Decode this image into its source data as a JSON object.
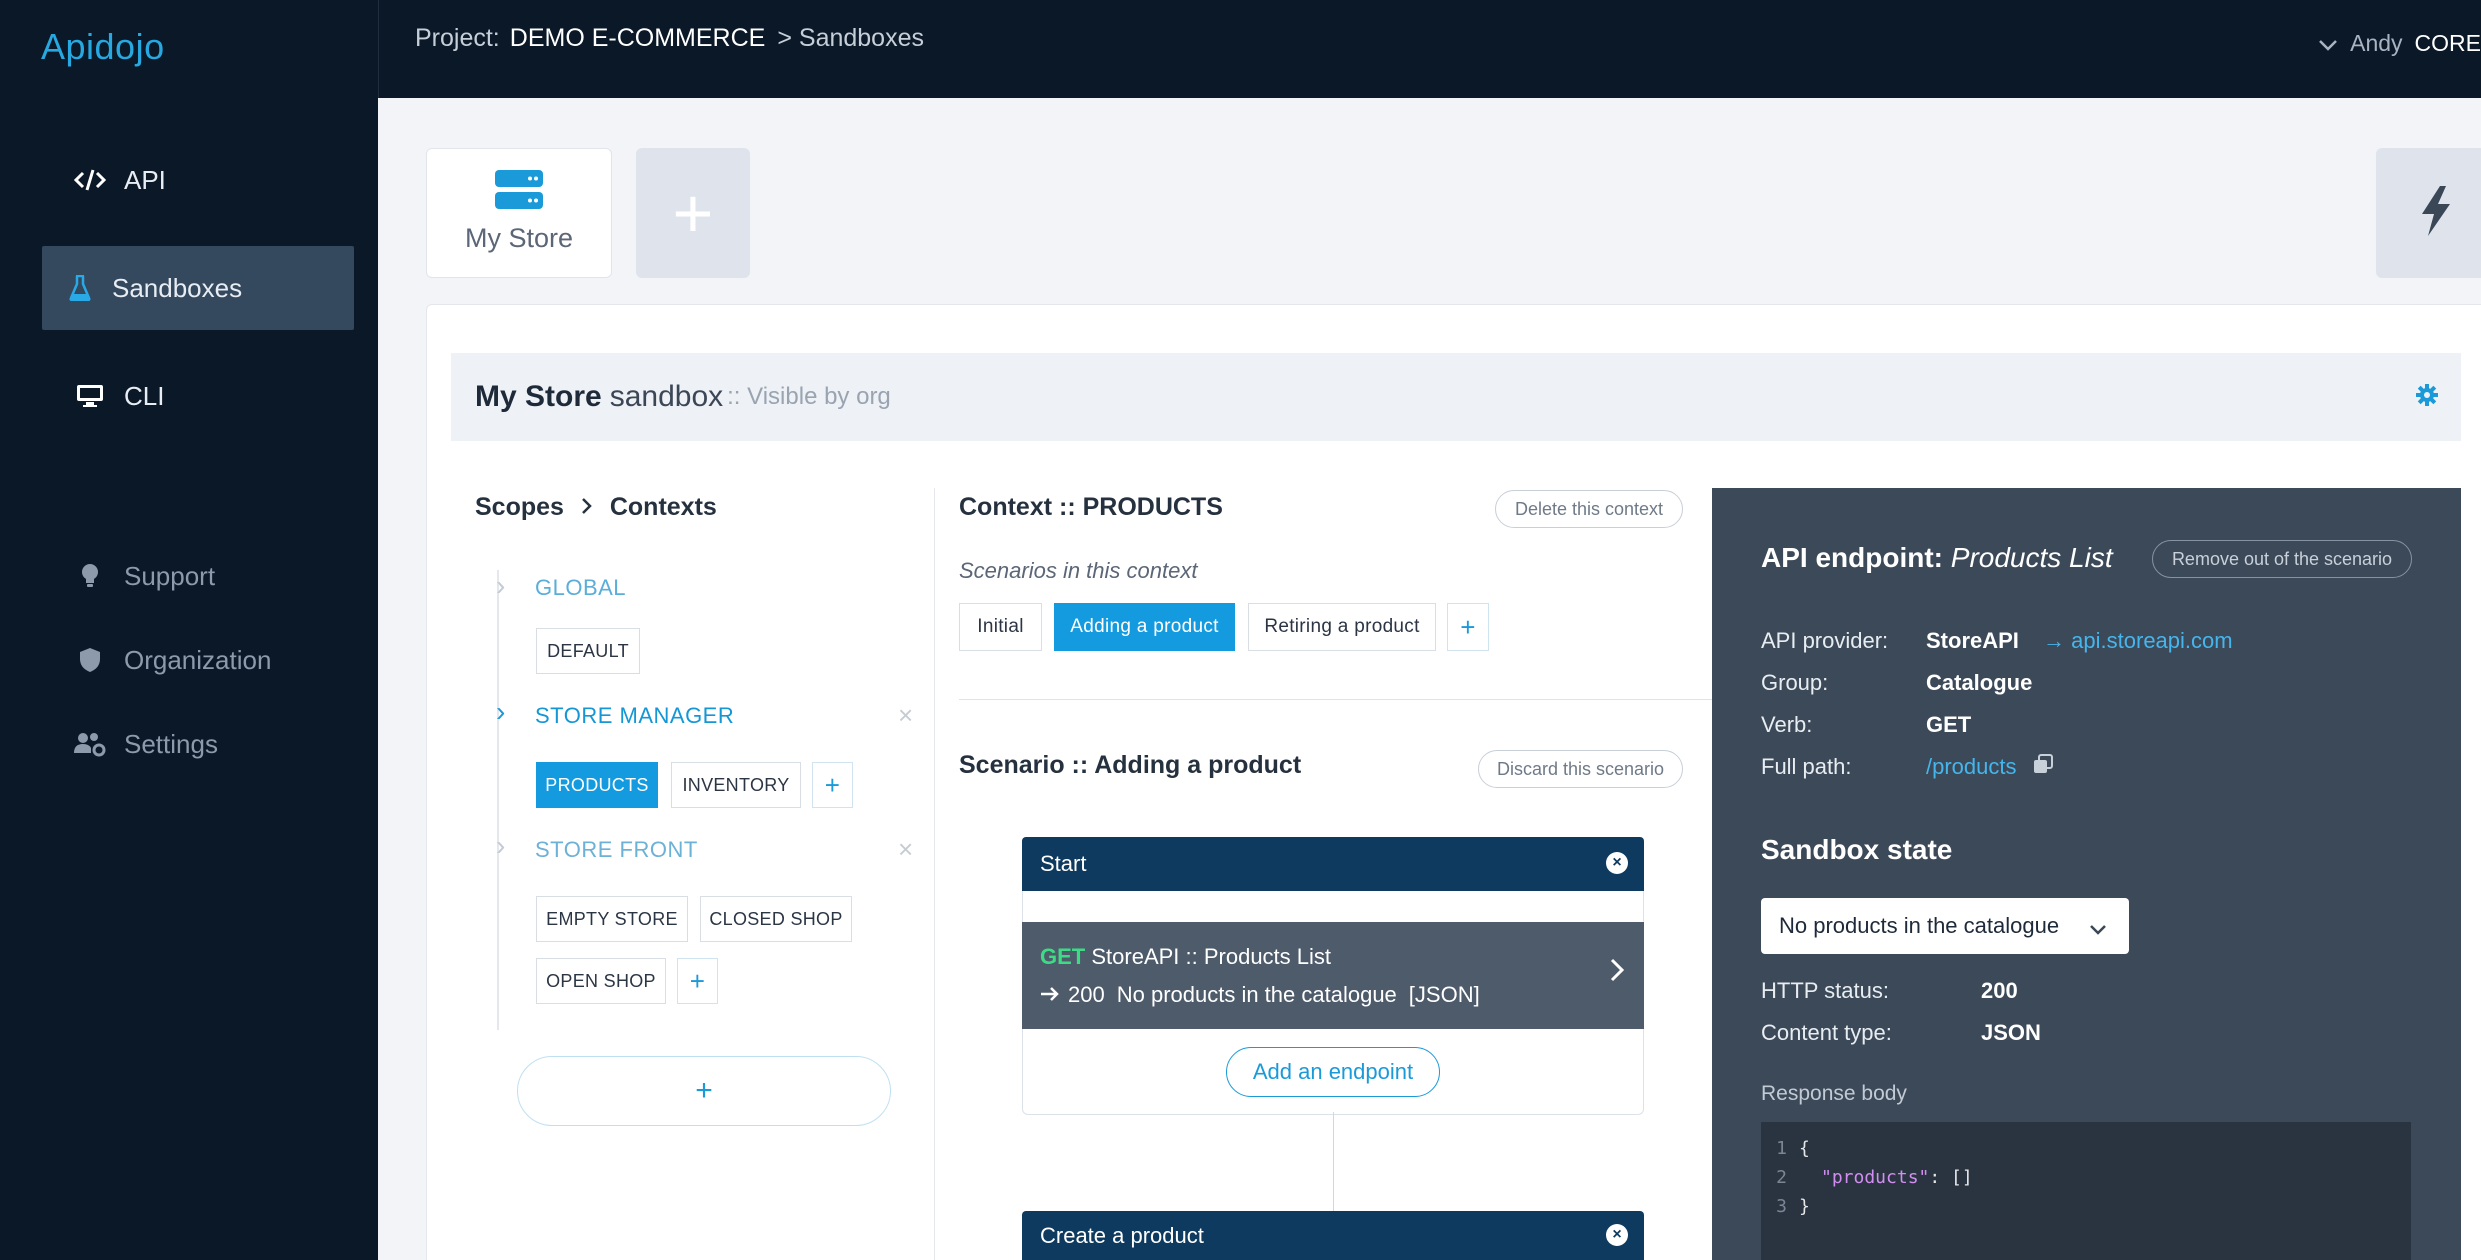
{
  "app": {
    "brand": "Apidojo"
  },
  "sidebar": {
    "items": [
      {
        "label": "API",
        "icon": "code-icon"
      },
      {
        "label": "Sandboxes",
        "icon": "flask-icon"
      },
      {
        "label": "CLI",
        "icon": "monitor-icon"
      }
    ],
    "secondary": [
      {
        "label": "Support",
        "icon": "lightbulb-icon"
      },
      {
        "label": "Organization",
        "icon": "shield-icon"
      },
      {
        "label": "Settings",
        "icon": "users-gear-icon"
      }
    ]
  },
  "topbar": {
    "project_prefix": "Project:",
    "project_name": "DEMO E-COMMERCE",
    "separator": ">",
    "current": "Sandboxes",
    "user": "Andy",
    "org": "CORE"
  },
  "tiles": {
    "store_label": "My Store",
    "add_symbol": "+"
  },
  "sandbox": {
    "name": "My Store",
    "kind": "sandbox",
    "visibility": ":: Visible by org"
  },
  "scopes": {
    "title_scopes": "Scopes",
    "title_contexts": "Contexts",
    "global": {
      "label": "GLOBAL",
      "chips": [
        "DEFAULT"
      ]
    },
    "manager": {
      "label": "STORE MANAGER",
      "chips": [
        "PRODUCTS",
        "INVENTORY"
      ]
    },
    "front": {
      "label": "STORE FRONT",
      "chips": [
        "EMPTY STORE",
        "CLOSED SHOP",
        "OPEN SHOP"
      ]
    },
    "add": "+"
  },
  "context": {
    "title": "Context :: PRODUCTS",
    "delete_label": "Delete this context",
    "scenarios_label": "Scenarios in this context",
    "scenarios": [
      "Initial",
      "Adding a product",
      "Retiring a product"
    ],
    "active_scenario": "Adding a product"
  },
  "scenario": {
    "title": "Scenario :: Adding a product",
    "discard_label": "Discard this scenario",
    "start_label": "Start",
    "endpoint_verb": "GET",
    "endpoint_name": "StoreAPI :: Products List",
    "endpoint_status": "200",
    "endpoint_state": "No products in the catalogue",
    "endpoint_format": "[JSON]",
    "add_endpoint_label": "Add an endpoint",
    "next_step_label": "Create a product",
    "close_symbol": "×"
  },
  "api_panel": {
    "title_bold": "API endpoint:",
    "title_italic": "Products List",
    "remove_label": "Remove out of the scenario",
    "provider_label": "API provider:",
    "provider_value": "StoreAPI",
    "provider_link": "api.storeapi.com",
    "group_label": "Group:",
    "group_value": "Catalogue",
    "verb_label": "Verb:",
    "verb_value": "GET",
    "path_label": "Full path:",
    "path_value": "/products",
    "state_title": "Sandbox state",
    "state_selected": "No products in the catalogue",
    "http_label": "HTTP status:",
    "http_value": "200",
    "ctype_label": "Content type:",
    "ctype_value": "JSON",
    "body_label": "Response body",
    "code": [
      {
        "num": "1",
        "text": "{"
      },
      {
        "num": "2",
        "key": "\"products\"",
        "rest": ": []"
      },
      {
        "num": "3",
        "text": "}"
      }
    ]
  },
  "colors": {
    "accent": "#149bdf",
    "sidebar": "#0b1828",
    "header_dark": "#0e3a5f",
    "api_panel": "#3c4958"
  }
}
